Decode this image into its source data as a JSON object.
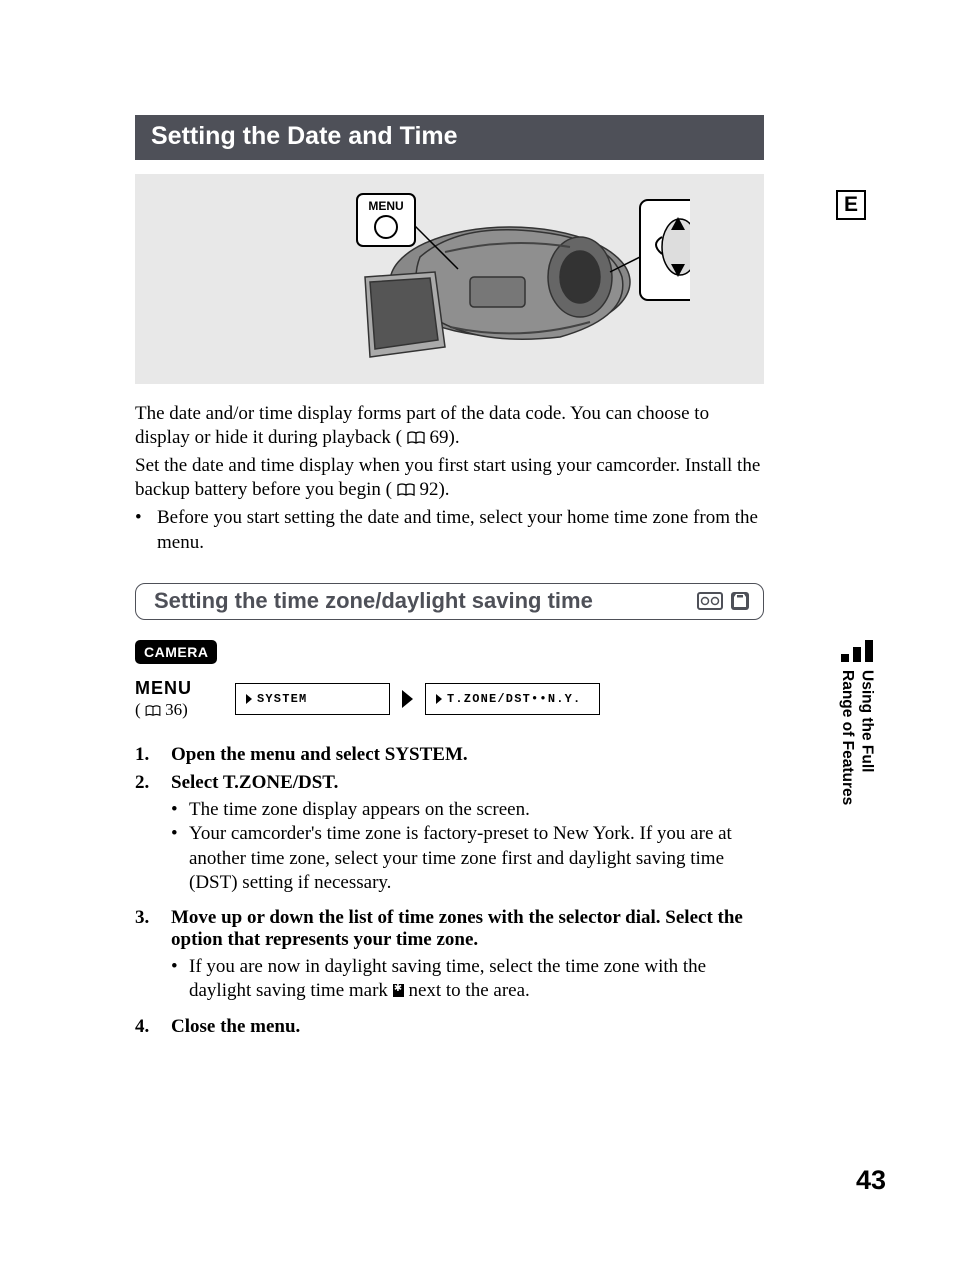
{
  "page": {
    "title": "Setting the Date and Time",
    "lang_badge": "E",
    "number": "43"
  },
  "hero": {
    "menu_callout": "MENU"
  },
  "intro": {
    "p1a": "The date and/or time display forms part of the data code. You can choose to display or hide it during playback (",
    "p1_ref": "69",
    "p1b": ").",
    "p2a": "Set the date and time display when you first start using your camcorder. Install the backup battery before you begin (",
    "p2_ref": "92",
    "p2b": ").",
    "bullet": "Before you start setting the date and time, select your home time zone from the menu."
  },
  "subsection": {
    "title": "Setting the time zone/daylight saving time",
    "mode_badge": "CAMERA",
    "menu_label": "MENU",
    "menu_ref_page": "36",
    "nav1": "SYSTEM",
    "nav2": "T.ZONE/DST••N.Y."
  },
  "steps": [
    {
      "num": "1.",
      "title": "Open the menu and select SYSTEM."
    },
    {
      "num": "2.",
      "title": "Select T.ZONE/DST.",
      "items": [
        "The time zone display appears on the screen.",
        "Your camcorder's time zone is factory-preset to New York. If you are at another time zone, select your time zone first and daylight saving time (DST) setting if necessary."
      ]
    },
    {
      "num": "3.",
      "title": "Move up or down the list of time zones with the selector dial. Select the option that represents your time zone.",
      "items_pre": "If you are now in daylight saving time, select the time zone with the daylight saving time mark ",
      "items_post": " next to the area."
    },
    {
      "num": "4.",
      "title": "Close the menu."
    }
  ],
  "side_tab": {
    "line1": "Using the Full",
    "line2": "Range of Features"
  }
}
